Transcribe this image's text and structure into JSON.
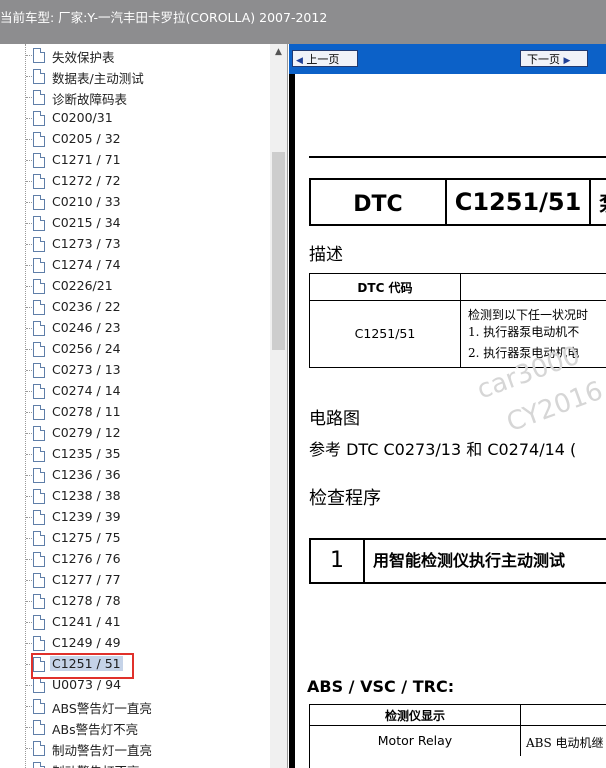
{
  "window": {
    "title": "当前车型:  厂家:Y-一汽丰田卡罗拉(COROLLA) 2007-2012"
  },
  "tree": {
    "items": [
      {
        "label": "失效保护表"
      },
      {
        "label": "数据表/主动测试"
      },
      {
        "label": "诊断故障码表"
      },
      {
        "label": "C0200/31"
      },
      {
        "label": "C0205 / 32"
      },
      {
        "label": "C1271 / 71"
      },
      {
        "label": "C1272 / 72"
      },
      {
        "label": "C0210 / 33"
      },
      {
        "label": "C0215 / 34"
      },
      {
        "label": "C1273 / 73"
      },
      {
        "label": "C1274 / 74"
      },
      {
        "label": "C0226/21"
      },
      {
        "label": "C0236 / 22"
      },
      {
        "label": "C0246 / 23"
      },
      {
        "label": "C0256 / 24"
      },
      {
        "label": "C0273 / 13"
      },
      {
        "label": "C0274 / 14"
      },
      {
        "label": "C0278 / 11"
      },
      {
        "label": "C0279 / 12"
      },
      {
        "label": "C1235 / 35"
      },
      {
        "label": "C1236 / 36"
      },
      {
        "label": "C1238 / 38"
      },
      {
        "label": "C1239 / 39"
      },
      {
        "label": "C1275 / 75"
      },
      {
        "label": "C1276 / 76"
      },
      {
        "label": "C1277 / 77"
      },
      {
        "label": "C1278 / 78"
      },
      {
        "label": "C1241 / 41"
      },
      {
        "label": "C1249 / 49"
      },
      {
        "label": "C1251 / 51",
        "selected": true
      },
      {
        "label": "U0073 / 94"
      },
      {
        "label": "ABS警告灯一直亮"
      },
      {
        "label": "ABs警告灯不亮"
      },
      {
        "label": "制动警告灯一直亮"
      },
      {
        "label": "制动警告灯不亮"
      }
    ]
  },
  "toolbar": {
    "prev_label": "上一页",
    "next_label": "下一页",
    "arrow_left": "◀",
    "arrow_right": "▶"
  },
  "document": {
    "dtc_label": "DTC",
    "dtc_code": "C1251/51",
    "dtc_title_partial": "泵",
    "description_heading": "描述",
    "table_header_code": "DTC 代码",
    "table_code_value": "C1251/51",
    "table_line1": "检测到以下任一状况时",
    "table_line2": "1.   执行器泵电动机不",
    "table_line3": "2.   执行器泵电动机电",
    "watermark_1": "car3000",
    "watermark_2": "CY2016",
    "circuit_heading": "电路图",
    "circuit_reference": "参考 DTC C0273/13 和 C0274/14  (",
    "procedure_heading": "检查程序",
    "step_number": "1",
    "step_text": "用智能检测仪执行主动测试",
    "abs_title": "ABS / VSC / TRC:",
    "abs_table_header": "检测仪显示",
    "abs_table_row_label": "Motor Relay",
    "abs_table_row_value": "ABS 电动机继"
  },
  "colors": {
    "titlebar": "#8d8d8f",
    "toolbar": "#0c61c8",
    "selection": "#c5d3e8",
    "highlight": "#e0312b"
  }
}
